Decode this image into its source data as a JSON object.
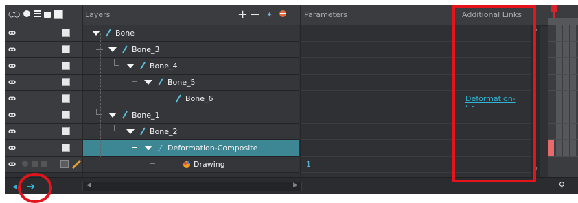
{
  "header": {
    "layers_label": "Layers",
    "parameters_label": "Parameters",
    "additional_links_label": "Additional Links"
  },
  "layers": [
    {
      "name": "Bone",
      "indent": 0,
      "expanded": true,
      "type": "bone"
    },
    {
      "name": "Bone_3",
      "indent": 1,
      "expanded": true,
      "type": "bone"
    },
    {
      "name": "Bone_4",
      "indent": 2,
      "expanded": true,
      "type": "bone"
    },
    {
      "name": "Bone_5",
      "indent": 3,
      "expanded": true,
      "type": "bone"
    },
    {
      "name": "Bone_6",
      "indent": 4,
      "expanded": false,
      "type": "bone",
      "additional_link": "Deformation-Co..."
    },
    {
      "name": "Bone_1",
      "indent": 1,
      "expanded": true,
      "type": "bone"
    },
    {
      "name": "Bone_2",
      "indent": 2,
      "expanded": true,
      "type": "bone"
    },
    {
      "name": "Deformation-Composite",
      "indent": 3,
      "expanded": true,
      "type": "composite",
      "selected": true
    },
    {
      "name": "Drawing",
      "indent": 4,
      "expanded": false,
      "type": "drawing",
      "parameter": "1"
    }
  ],
  "icons": {
    "visibility": "eye-icon",
    "add": "plus-icon",
    "remove": "minus-icon",
    "bone": "bone-icon",
    "drawing": "drawing-icon",
    "pencil": "pencil-icon",
    "arrow": "right-arrow-icon",
    "zoom": "magnifier-icon"
  },
  "colors": {
    "selection": "#3d8794",
    "link": "#2fb6d8",
    "highlight": "#e3141b",
    "playhead": "#d8232a"
  }
}
